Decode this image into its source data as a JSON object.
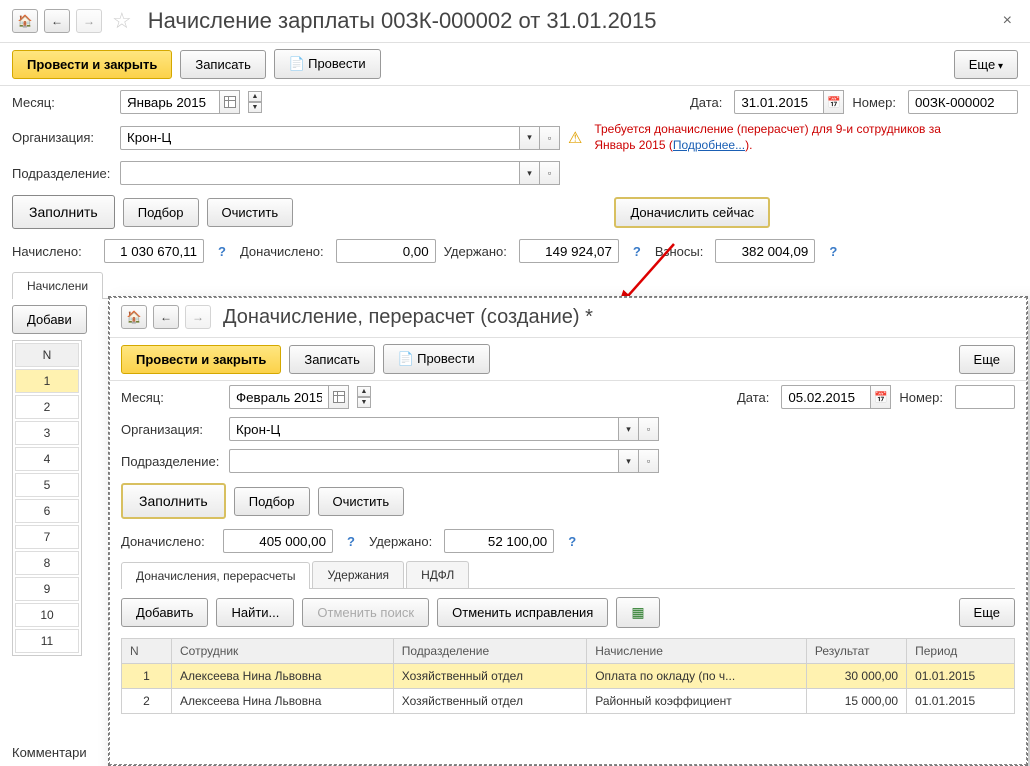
{
  "main": {
    "title": "Начисление зарплаты 00ЗК-000002 от 31.01.2015",
    "toolbar": {
      "post_close": "Провести и закрыть",
      "save": "Записать",
      "post": "Провести",
      "more": "Еще"
    },
    "labels": {
      "month": "Месяц:",
      "org": "Организация:",
      "dept": "Подразделение:",
      "date": "Дата:",
      "number": "Номер:",
      "accrued": "Начислено:",
      "extra": "Доначислено:",
      "withheld": "Удержано:",
      "contrib": "Взносы:",
      "comment": "Комментари"
    },
    "values": {
      "month": "Январь 2015",
      "org": "Крон-Ц",
      "dept": "",
      "date": "31.01.2015",
      "number": "00ЗК-000002",
      "accrued": "1 030 670,11",
      "extra": "0,00",
      "withheld": "149 924,07",
      "contrib": "382 004,09"
    },
    "warn": {
      "text1": "Требуется доначисление (перерасчет) для 9-и сотрудников за Январь 2015 (",
      "link": "Подробнее...",
      "text2": ")."
    },
    "buttons": {
      "fill": "Заполнить",
      "pick": "Подбор",
      "clear": "Очистить",
      "recalc_now": "Доначислить сейчас",
      "add": "Добави"
    },
    "tabs": {
      "accruals": "Начислени"
    },
    "ntable": {
      "header": "N",
      "rows": [
        "1",
        "2",
        "3",
        "4",
        "5",
        "6",
        "7",
        "8",
        "9",
        "10",
        "11"
      ]
    }
  },
  "sub": {
    "title": "Доначисление, перерасчет (создание) *",
    "toolbar": {
      "post_close": "Провести и закрыть",
      "save": "Записать",
      "post": "Провести",
      "more": "Еще"
    },
    "labels": {
      "month": "Месяц:",
      "org": "Организация:",
      "dept": "Подразделение:",
      "date": "Дата:",
      "number": "Номер:",
      "extra": "Доначислено:",
      "withheld": "Удержано:"
    },
    "values": {
      "month": "Февраль 2015",
      "org": "Крон-Ц",
      "dept": "",
      "date": "05.02.2015",
      "number": "",
      "extra": "405 000,00",
      "withheld": "52 100,00"
    },
    "buttons": {
      "fill": "Заполнить",
      "pick": "Подбор",
      "clear": "Очистить",
      "add": "Добавить",
      "find": "Найти...",
      "cancel_find": "Отменить поиск",
      "cancel_fix": "Отменить исправления",
      "more": "Еще"
    },
    "tabs": {
      "t1": "Доначисления, перерасчеты",
      "t2": "Удержания",
      "t3": "НДФЛ"
    },
    "table": {
      "headers": {
        "n": "N",
        "emp": "Сотрудник",
        "dept": "Подразделение",
        "acc": "Начисление",
        "res": "Результат",
        "per": "Период"
      },
      "rows": [
        {
          "n": "1",
          "emp": "Алексеева Нина Львовна",
          "dept": "Хозяйственный отдел",
          "acc": "Оплата по окладу (по ч...",
          "res": "30 000,00",
          "per": "01.01.2015"
        },
        {
          "n": "2",
          "emp": "Алексеева Нина Львовна",
          "dept": "Хозяйственный отдел",
          "acc": "Районный коэффициент",
          "res": "15 000,00",
          "per": "01.01.2015"
        }
      ]
    }
  }
}
